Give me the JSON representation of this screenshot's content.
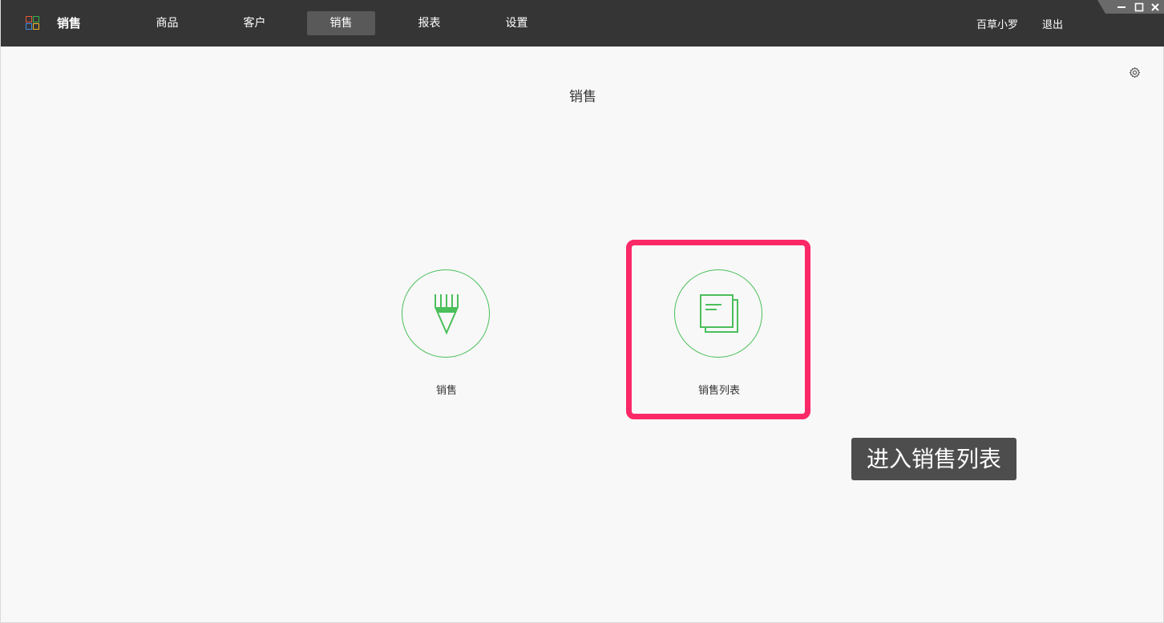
{
  "header": {
    "app_title": "销售",
    "nav": [
      {
        "label": "商品",
        "active": false
      },
      {
        "label": "客户",
        "active": false
      },
      {
        "label": "销售",
        "active": true
      },
      {
        "label": "报表",
        "active": false
      },
      {
        "label": "设置",
        "active": false
      }
    ],
    "user_name": "百草小罗",
    "logout_label": "退出",
    "logo_icon": "grid-logo-icon",
    "window_controls": [
      "minimize-icon",
      "maximize-icon",
      "close-icon"
    ]
  },
  "main": {
    "page_title": "销售",
    "settings_icon": "gear-icon",
    "tiles": [
      {
        "label": "销售",
        "icon": "pencil-icon"
      },
      {
        "label": "销售列表",
        "icon": "document-list-icon"
      }
    ],
    "tooltip": "进入销售列表"
  },
  "colors": {
    "topbar_bg": "#353535",
    "nav_active_bg": "#595959",
    "accent_green": "#4bbf5b",
    "highlight": "#fb2868",
    "tooltip_bg": "#4d4d4d",
    "page_bg": "#f8f8f8"
  }
}
